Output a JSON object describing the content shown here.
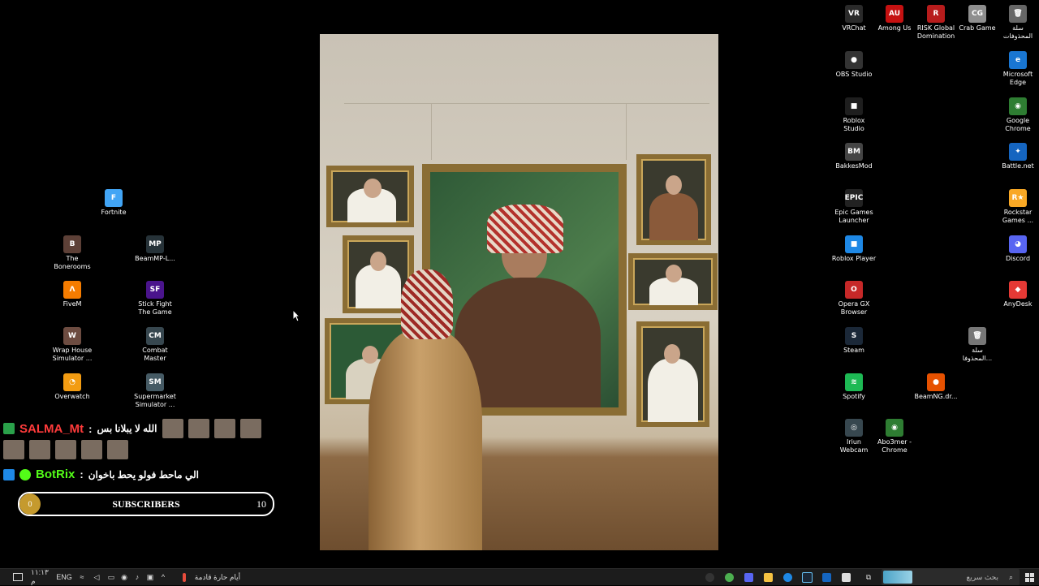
{
  "desktop_icons": [
    {
      "name": "VRChat",
      "lines": [
        "VRChat"
      ],
      "color": "#2a2a2a",
      "glyph": "VR"
    },
    {
      "name": "Among Us",
      "lines": [
        "Among Us"
      ],
      "color": "#c51111",
      "glyph": "AU"
    },
    {
      "name": "RISK Global Domination",
      "lines": [
        "RISK Global",
        "Domination"
      ],
      "color": "#b71c1c",
      "glyph": "R"
    },
    {
      "name": "Crab Game",
      "lines": [
        "Crab Game"
      ],
      "color": "#8e8e8e",
      "glyph": "CG"
    },
    {
      "name": "Recycle Bin",
      "lines": [
        "سلة",
        "المحذوفات"
      ],
      "color": "#666",
      "glyph": "🗑"
    },
    {
      "name": "OBS Studio",
      "lines": [
        "OBS Studio"
      ],
      "color": "#333",
      "glyph": "●"
    },
    {
      "name": "Microsoft Edge",
      "lines": [
        "Microsoft",
        "Edge"
      ],
      "color": "#1976d2",
      "glyph": "e"
    },
    {
      "name": "Roblox Studio",
      "lines": [
        "Roblox",
        "Studio"
      ],
      "color": "#1e1e1e",
      "glyph": "■"
    },
    {
      "name": "Google Chrome",
      "lines": [
        "Google",
        "Chrome"
      ],
      "color": "#2e7d32",
      "glyph": "◉"
    },
    {
      "name": "BakkesMod",
      "lines": [
        "BakkesMod"
      ],
      "color": "#444",
      "glyph": "BM"
    },
    {
      "name": "Battle.net",
      "lines": [
        "Battle.net"
      ],
      "color": "#1565c0",
      "glyph": "✦"
    },
    {
      "name": "Epic Games Launcher",
      "lines": [
        "Epic Games",
        "Launcher"
      ],
      "color": "#222",
      "glyph": "EPIC"
    },
    {
      "name": "Rockstar Games",
      "lines": [
        "Rockstar",
        "Games ..."
      ],
      "color": "#f9a825",
      "glyph": "R★"
    },
    {
      "name": "Roblox Player",
      "lines": [
        "Roblox Player"
      ],
      "color": "#1e88e5",
      "glyph": "■"
    },
    {
      "name": "Discord",
      "lines": [
        "Discord"
      ],
      "color": "#5865f2",
      "glyph": "◕"
    },
    {
      "name": "Opera GX Browser",
      "lines": [
        "Opera GX",
        "Browser"
      ],
      "color": "#c62828",
      "glyph": "O"
    },
    {
      "name": "AnyDesk",
      "lines": [
        "AnyDesk"
      ],
      "color": "#e53935",
      "glyph": "◆"
    },
    {
      "name": "Steam",
      "lines": [
        "Steam"
      ],
      "color": "#1b2838",
      "glyph": "S"
    },
    {
      "name": "Recycle Bin 2",
      "lines": [
        "سلة",
        "المحذوفا..."
      ],
      "color": "#777",
      "glyph": "🗑"
    },
    {
      "name": "Spotify",
      "lines": [
        "Spotify"
      ],
      "color": "#1db954",
      "glyph": "≋"
    },
    {
      "name": "BeamNG.drive",
      "lines": [
        "BeamNG.dr..."
      ],
      "color": "#e65100",
      "glyph": "●"
    },
    {
      "name": "Iriun Webcam",
      "lines": [
        "Iriun",
        "Webcam"
      ],
      "color": "#37474f",
      "glyph": "◎"
    },
    {
      "name": "Abo3mer - Chrome",
      "lines": [
        "Abo3mer -",
        "Chrome"
      ],
      "color": "#2e7d32",
      "glyph": "◉"
    },
    {
      "name": "Fortnite",
      "lines": [
        "Fortnite"
      ],
      "color": "#42a5f5",
      "glyph": "F"
    },
    {
      "name": "The Bonerooms",
      "lines": [
        "The",
        "Bonerooms"
      ],
      "color": "#5d4037",
      "glyph": "B"
    },
    {
      "name": "BeamMP-Launcher",
      "lines": [
        "BeamMP-L..."
      ],
      "color": "#263238",
      "glyph": "MP"
    },
    {
      "name": "FiveM",
      "lines": [
        "FiveM"
      ],
      "color": "#f57c00",
      "glyph": "Λ"
    },
    {
      "name": "Stick Fight The Game",
      "lines": [
        "Stick Fight",
        "The Game"
      ],
      "color": "#4a148c",
      "glyph": "SF"
    },
    {
      "name": "Wrap House Simulator",
      "lines": [
        "Wrap House",
        "Simulator ..."
      ],
      "color": "#6d4c41",
      "glyph": "W"
    },
    {
      "name": "Combat Master",
      "lines": [
        "Combat",
        "Master"
      ],
      "color": "#37474f",
      "glyph": "CM"
    },
    {
      "name": "Overwatch",
      "lines": [
        "Overwatch"
      ],
      "color": "#f39c12",
      "glyph": "◔"
    },
    {
      "name": "Supermarket Simulator",
      "lines": [
        "Supermarket",
        "Simulator ..."
      ],
      "color": "#455a64",
      "glyph": "SM"
    }
  ],
  "chat": {
    "msg1_user": "SALMA_Mt",
    "msg1_text": "الله لا يبلانا بس",
    "msg1_user_color": "#ff3b3b",
    "msg2_user": "BotRix",
    "msg2_text": "الي ماحط فولو يحط باخوان",
    "msg2_user_color": "#53fc18"
  },
  "subscribers": {
    "title": "SUBSCRIBERS",
    "current": "0",
    "goal": "10",
    "current_fraction": 0
  },
  "taskbar": {
    "language": "ENG",
    "time": "١١:١٣ م",
    "weather_text": "أيام حارة قادمة",
    "search_placeholder": "بحث سريع"
  }
}
